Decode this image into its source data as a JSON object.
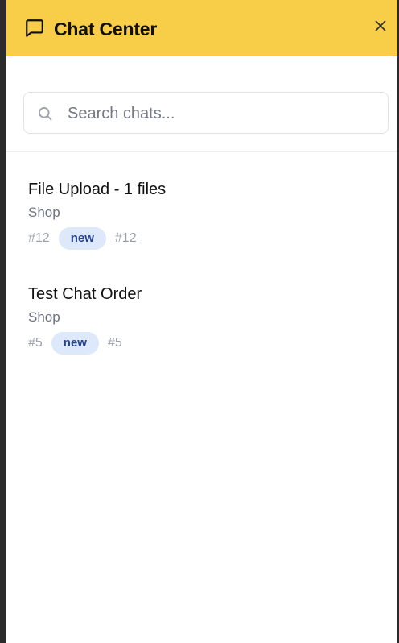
{
  "header": {
    "title": "Chat Center",
    "icon": "chat-bubble-icon",
    "close_icon": "close-icon",
    "background": "#f8cd48"
  },
  "search": {
    "placeholder": "Search chats...",
    "value": "",
    "icon": "search-icon"
  },
  "chats": [
    {
      "title": "File Upload - 1 files",
      "subtitle": "Shop",
      "id_left": "#12",
      "status": "new",
      "id_right": "#12"
    },
    {
      "title": "Test Chat Order",
      "subtitle": "Shop",
      "id_left": "#5",
      "status": "new",
      "id_right": "#5"
    }
  ],
  "colors": {
    "badge_bg": "#dde8fb",
    "badge_text": "#27438f"
  }
}
